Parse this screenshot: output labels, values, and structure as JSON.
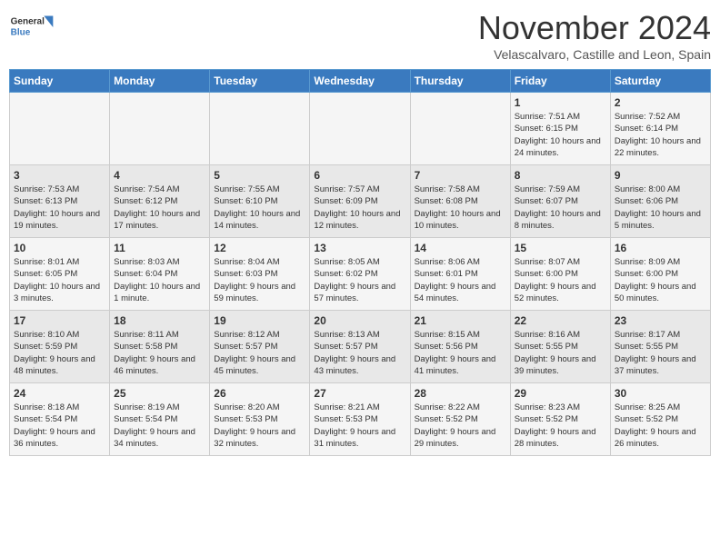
{
  "header": {
    "logo_line1": "General",
    "logo_line2": "Blue",
    "month": "November 2024",
    "location": "Velascalvaro, Castille and Leon, Spain"
  },
  "weekdays": [
    "Sunday",
    "Monday",
    "Tuesday",
    "Wednesday",
    "Thursday",
    "Friday",
    "Saturday"
  ],
  "weeks": [
    [
      {
        "day": "",
        "info": ""
      },
      {
        "day": "",
        "info": ""
      },
      {
        "day": "",
        "info": ""
      },
      {
        "day": "",
        "info": ""
      },
      {
        "day": "",
        "info": ""
      },
      {
        "day": "1",
        "info": "Sunrise: 7:51 AM\nSunset: 6:15 PM\nDaylight: 10 hours and 24 minutes."
      },
      {
        "day": "2",
        "info": "Sunrise: 7:52 AM\nSunset: 6:14 PM\nDaylight: 10 hours and 22 minutes."
      }
    ],
    [
      {
        "day": "3",
        "info": "Sunrise: 7:53 AM\nSunset: 6:13 PM\nDaylight: 10 hours and 19 minutes."
      },
      {
        "day": "4",
        "info": "Sunrise: 7:54 AM\nSunset: 6:12 PM\nDaylight: 10 hours and 17 minutes."
      },
      {
        "day": "5",
        "info": "Sunrise: 7:55 AM\nSunset: 6:10 PM\nDaylight: 10 hours and 14 minutes."
      },
      {
        "day": "6",
        "info": "Sunrise: 7:57 AM\nSunset: 6:09 PM\nDaylight: 10 hours and 12 minutes."
      },
      {
        "day": "7",
        "info": "Sunrise: 7:58 AM\nSunset: 6:08 PM\nDaylight: 10 hours and 10 minutes."
      },
      {
        "day": "8",
        "info": "Sunrise: 7:59 AM\nSunset: 6:07 PM\nDaylight: 10 hours and 8 minutes."
      },
      {
        "day": "9",
        "info": "Sunrise: 8:00 AM\nSunset: 6:06 PM\nDaylight: 10 hours and 5 minutes."
      }
    ],
    [
      {
        "day": "10",
        "info": "Sunrise: 8:01 AM\nSunset: 6:05 PM\nDaylight: 10 hours and 3 minutes."
      },
      {
        "day": "11",
        "info": "Sunrise: 8:03 AM\nSunset: 6:04 PM\nDaylight: 10 hours and 1 minute."
      },
      {
        "day": "12",
        "info": "Sunrise: 8:04 AM\nSunset: 6:03 PM\nDaylight: 9 hours and 59 minutes."
      },
      {
        "day": "13",
        "info": "Sunrise: 8:05 AM\nSunset: 6:02 PM\nDaylight: 9 hours and 57 minutes."
      },
      {
        "day": "14",
        "info": "Sunrise: 8:06 AM\nSunset: 6:01 PM\nDaylight: 9 hours and 54 minutes."
      },
      {
        "day": "15",
        "info": "Sunrise: 8:07 AM\nSunset: 6:00 PM\nDaylight: 9 hours and 52 minutes."
      },
      {
        "day": "16",
        "info": "Sunrise: 8:09 AM\nSunset: 6:00 PM\nDaylight: 9 hours and 50 minutes."
      }
    ],
    [
      {
        "day": "17",
        "info": "Sunrise: 8:10 AM\nSunset: 5:59 PM\nDaylight: 9 hours and 48 minutes."
      },
      {
        "day": "18",
        "info": "Sunrise: 8:11 AM\nSunset: 5:58 PM\nDaylight: 9 hours and 46 minutes."
      },
      {
        "day": "19",
        "info": "Sunrise: 8:12 AM\nSunset: 5:57 PM\nDaylight: 9 hours and 45 minutes."
      },
      {
        "day": "20",
        "info": "Sunrise: 8:13 AM\nSunset: 5:57 PM\nDaylight: 9 hours and 43 minutes."
      },
      {
        "day": "21",
        "info": "Sunrise: 8:15 AM\nSunset: 5:56 PM\nDaylight: 9 hours and 41 minutes."
      },
      {
        "day": "22",
        "info": "Sunrise: 8:16 AM\nSunset: 5:55 PM\nDaylight: 9 hours and 39 minutes."
      },
      {
        "day": "23",
        "info": "Sunrise: 8:17 AM\nSunset: 5:55 PM\nDaylight: 9 hours and 37 minutes."
      }
    ],
    [
      {
        "day": "24",
        "info": "Sunrise: 8:18 AM\nSunset: 5:54 PM\nDaylight: 9 hours and 36 minutes."
      },
      {
        "day": "25",
        "info": "Sunrise: 8:19 AM\nSunset: 5:54 PM\nDaylight: 9 hours and 34 minutes."
      },
      {
        "day": "26",
        "info": "Sunrise: 8:20 AM\nSunset: 5:53 PM\nDaylight: 9 hours and 32 minutes."
      },
      {
        "day": "27",
        "info": "Sunrise: 8:21 AM\nSunset: 5:53 PM\nDaylight: 9 hours and 31 minutes."
      },
      {
        "day": "28",
        "info": "Sunrise: 8:22 AM\nSunset: 5:52 PM\nDaylight: 9 hours and 29 minutes."
      },
      {
        "day": "29",
        "info": "Sunrise: 8:23 AM\nSunset: 5:52 PM\nDaylight: 9 hours and 28 minutes."
      },
      {
        "day": "30",
        "info": "Sunrise: 8:25 AM\nSunset: 5:52 PM\nDaylight: 9 hours and 26 minutes."
      }
    ]
  ]
}
